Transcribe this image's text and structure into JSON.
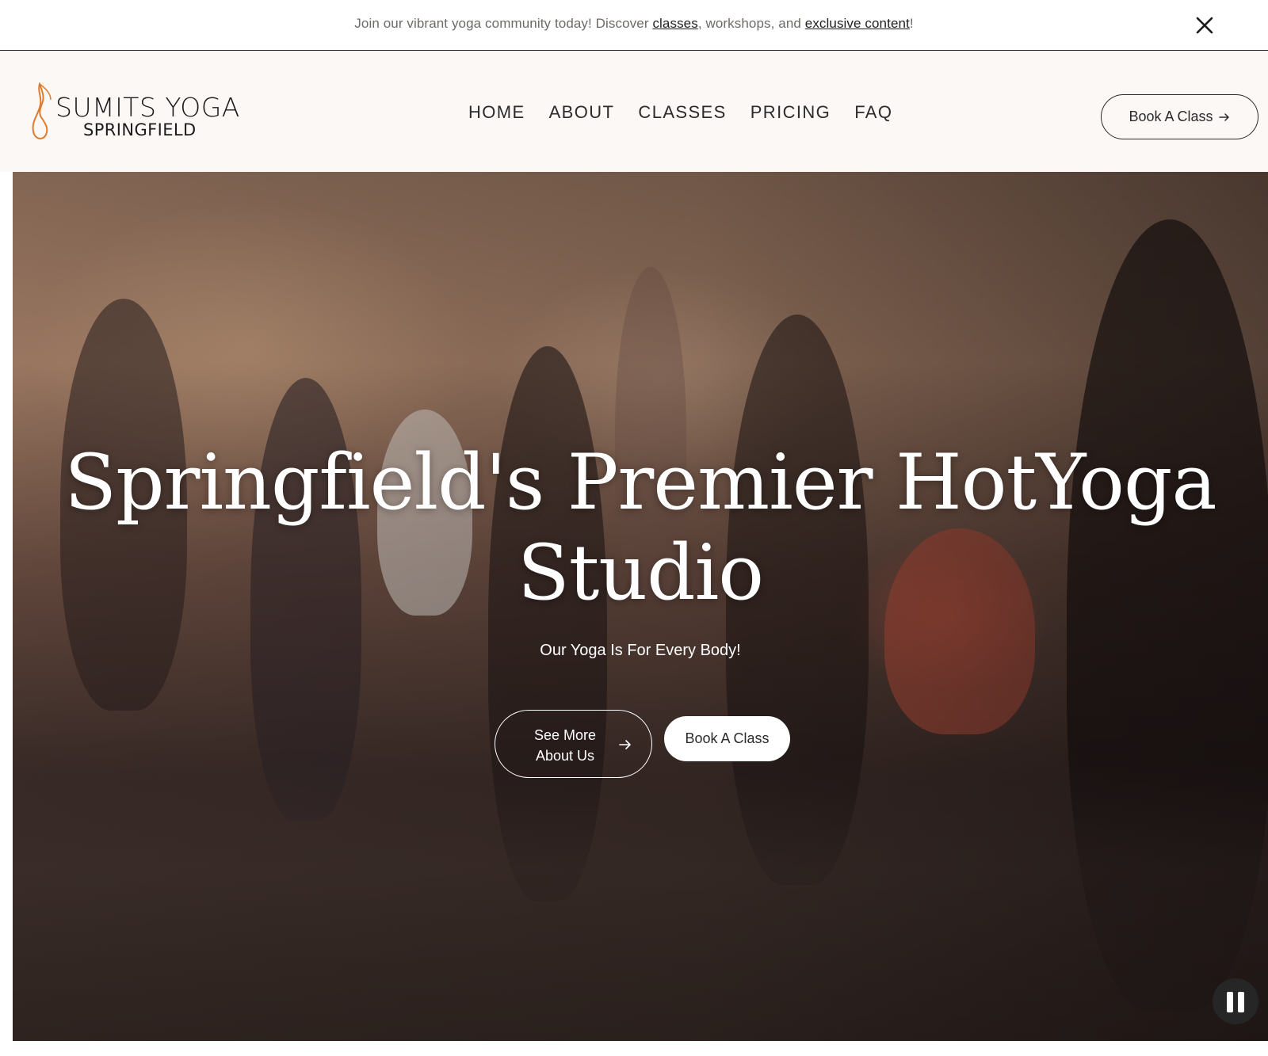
{
  "announcement": {
    "text_before": "Join our vibrant yoga community today! Discover ",
    "link_classes": "classes",
    "text_middle": ", workshops, and ",
    "link_exclusive": "exclusive content",
    "text_after": "!",
    "close_icon": "close-icon"
  },
  "header": {
    "logo_title": "SUMITS YOGA",
    "logo_sub": "SPRINGFIELD",
    "nav": [
      {
        "label": "HOME"
      },
      {
        "label": "ABOUT"
      },
      {
        "label": "CLASSES"
      },
      {
        "label": "PRICING"
      },
      {
        "label": "FAQ"
      }
    ],
    "book_label": "Book A Class",
    "arrow_icon": "arrow-right-icon"
  },
  "hero": {
    "title_line1": "Springfield's Premier HotYoga",
    "title_line2": "Studio",
    "subtitle": "Our Yoga Is For Every Body!",
    "about_line1": "See More",
    "about_line2": "About Us",
    "book_label": "Book A Class",
    "pause_icon": "pause-icon"
  },
  "colors": {
    "accent_logo": "#e07b2e",
    "text_dark": "#1f1f1f",
    "header_bg": "#fcf8f6"
  }
}
